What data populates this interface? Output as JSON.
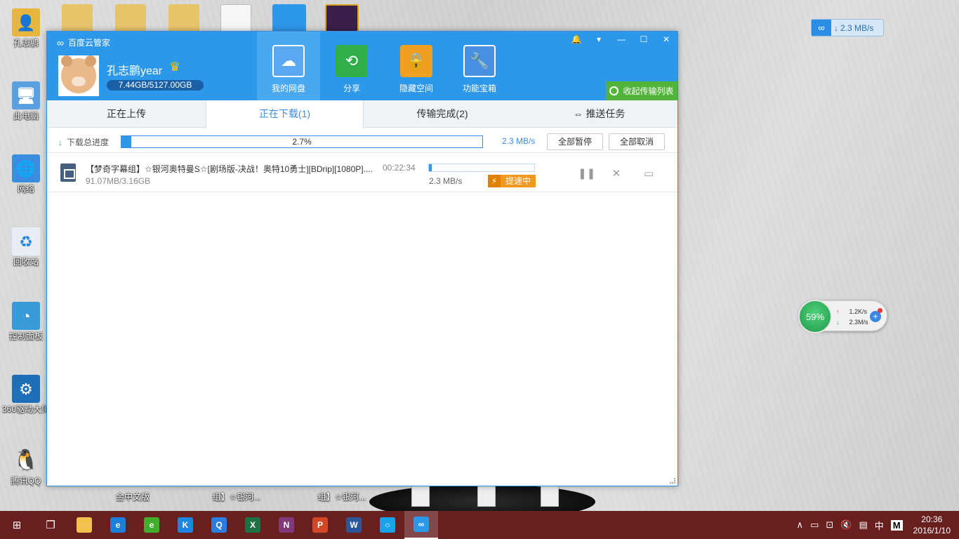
{
  "desktop": {
    "icons": [
      {
        "label": "孔志鹏",
        "icon": "user-folder-icon",
        "color": "#e6b640"
      },
      {
        "label": "此电脑",
        "icon": "computer-icon",
        "color": "#5aa0e0"
      },
      {
        "label": "网络",
        "icon": "network-icon",
        "color": "#3b8de0"
      },
      {
        "label": "回收站",
        "icon": "recycle-bin-icon",
        "color": "#c8d8e8"
      },
      {
        "label": "控制面板",
        "icon": "control-panel-icon",
        "color": "#3a9ad9"
      },
      {
        "label": "360驱动大师",
        "icon": "driver-master-icon",
        "color": "#1d6fb8"
      },
      {
        "label": "腾讯QQ",
        "icon": "qq-icon",
        "color": "#222222"
      }
    ],
    "partial_labels": [
      {
        "text": "金中文版"
      },
      {
        "text": "组】☆银河..."
      },
      {
        "text": "组】☆银河..."
      }
    ]
  },
  "speed_widget": {
    "value": "2.3 MB/s"
  },
  "ball_widget": {
    "percent": "59%",
    "up": "1.2K/s",
    "down": "2.3M/s"
  },
  "app": {
    "title": "百度云管家",
    "user": {
      "name": "孔志鹏year",
      "quota": "7.44GB/5127.00GB"
    },
    "nav": [
      {
        "label": "我的网盘",
        "icon": "cloud-drive-icon",
        "color": "#5aa8f0"
      },
      {
        "label": "分享",
        "icon": "share-icon",
        "color": "#2fae4a"
      },
      {
        "label": "隐藏空间",
        "icon": "lock-icon",
        "color": "#f0a020"
      },
      {
        "label": "功能宝箱",
        "icon": "toolbox-icon",
        "color": "#4a90e2"
      }
    ],
    "collapse_label": "收起传输列表",
    "tabs": [
      "正在上传",
      "正在下载(1)",
      "传输完成(2)",
      "推送任务"
    ],
    "total": {
      "label": "下载总进度",
      "percent": "2.7%",
      "progress": 0.027,
      "speed": "2.3 MB/s",
      "pause_all": "全部暂停",
      "cancel_all": "全部取消"
    },
    "task": {
      "name": "【梦奇字幕组】☆银河奥特曼S☆[剧场版-决战！奥特10勇士][BDrip][1080P]....",
      "size": "91.07MB/3.16GB",
      "time": "00:22:34",
      "progress": 0.028,
      "speed": "2.3 MB/s",
      "boost_label": "提速中"
    }
  },
  "taskbar": {
    "apps": [
      {
        "icon": "file-explorer-icon",
        "color": "#f2c14e",
        "text": ""
      },
      {
        "icon": "edge-icon",
        "color": "#1e7fd8",
        "text": "e"
      },
      {
        "icon": "360-browser-icon",
        "color": "#3fae2a",
        "text": "e"
      },
      {
        "icon": "kugou-icon",
        "color": "#1c86e0",
        "text": "K"
      },
      {
        "icon": "qq-browser-icon",
        "color": "#2a7de1",
        "text": "Q"
      },
      {
        "icon": "excel-icon",
        "color": "#1e7145",
        "text": "X"
      },
      {
        "icon": "onenote-icon",
        "color": "#80397b",
        "text": "N"
      },
      {
        "icon": "powerpoint-icon",
        "color": "#d24726",
        "text": "P"
      },
      {
        "icon": "word-icon",
        "color": "#2b579a",
        "text": "W"
      },
      {
        "icon": "app-icon",
        "color": "#1aa3e8",
        "text": "○"
      },
      {
        "icon": "baidu-cloud-icon",
        "color": "#2d97ea",
        "text": "∞"
      }
    ],
    "tray": {
      "ime": "中",
      "ime2": "M",
      "time": "20:36",
      "date": "2016/1/10"
    }
  }
}
